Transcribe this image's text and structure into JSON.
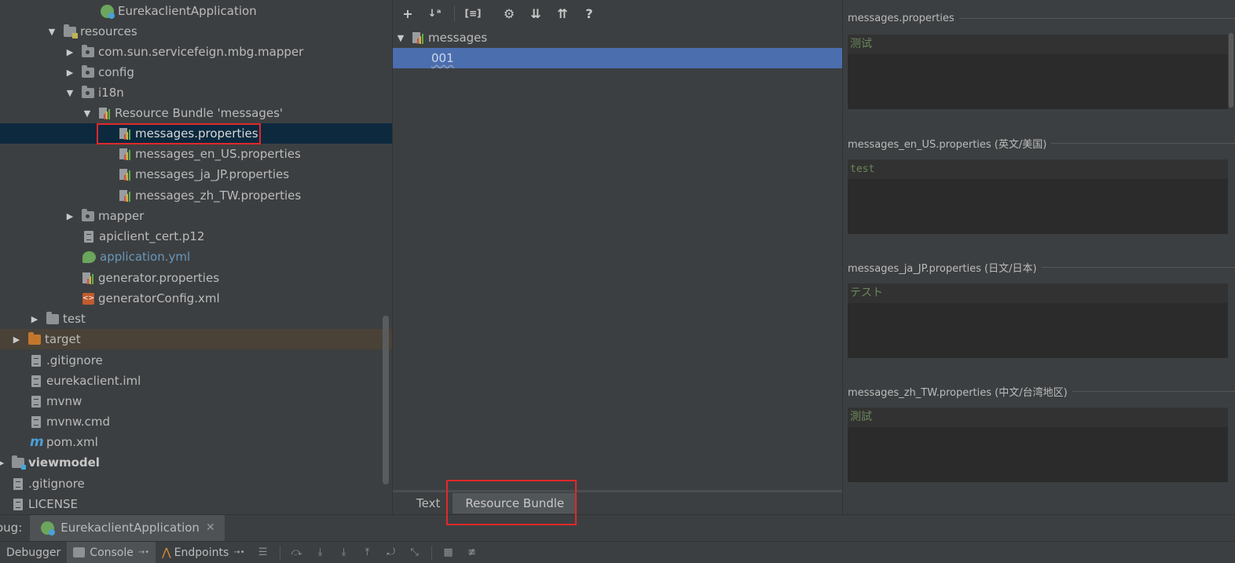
{
  "tree": {
    "items": [
      {
        "label": "EurekaclientApplication"
      },
      {
        "label": "resources"
      },
      {
        "label": "com.sun.servicefeign.mbg.mapper"
      },
      {
        "label": "config"
      },
      {
        "label": "i18n"
      },
      {
        "label": "Resource Bundle 'messages'"
      },
      {
        "label": "messages.properties"
      },
      {
        "label": "messages_en_US.properties"
      },
      {
        "label": "messages_ja_JP.properties"
      },
      {
        "label": "messages_zh_TW.properties"
      },
      {
        "label": "mapper"
      },
      {
        "label": "apiclient_cert.p12"
      },
      {
        "label": "application.yml"
      },
      {
        "label": "generator.properties"
      },
      {
        "label": "generatorConfig.xml"
      },
      {
        "label": "test"
      },
      {
        "label": "target"
      },
      {
        "label": ".gitignore"
      },
      {
        "label": "eurekaclient.iml"
      },
      {
        "label": "mvnw"
      },
      {
        "label": "mvnw.cmd"
      },
      {
        "label": "pom.xml"
      },
      {
        "label": "viewmodel"
      },
      {
        "label": ".gitignore"
      },
      {
        "label": "LICENSE"
      }
    ]
  },
  "bundle_editor": {
    "toolbar": {
      "add": "+",
      "sort": "↓ᵃ",
      "group": "[≡]",
      "settings": "⚙",
      "expand": "⇊",
      "collapse": "⇈",
      "help": "?"
    },
    "keys": [
      {
        "label": "messages"
      },
      {
        "label": "001"
      }
    ],
    "tabs": [
      {
        "label": "Text"
      },
      {
        "label": "Resource Bundle"
      }
    ]
  },
  "translations": [
    {
      "file": "messages.properties",
      "value": "测试"
    },
    {
      "file": "messages_en_US.properties (英文/美国)",
      "value": "test"
    },
    {
      "file": "messages_ja_JP.properties (日文/日本)",
      "value": "テスト"
    },
    {
      "file": "messages_zh_TW.properties (中文/台湾地区)",
      "value": "測試"
    }
  ],
  "debug": {
    "label": "oug:",
    "session_tab": "EurekaclientApplication",
    "tools": [
      {
        "label": "Debugger"
      },
      {
        "label": "Console"
      },
      {
        "label": "Endpoints"
      }
    ]
  }
}
